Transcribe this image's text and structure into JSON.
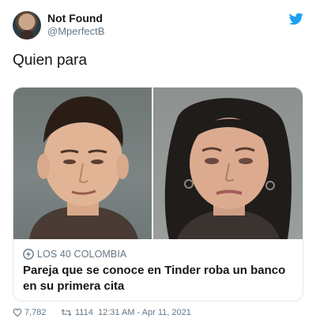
{
  "tweet": {
    "user_name": "Not Found",
    "user_handle": "@MperfectB",
    "text": "Quien para"
  },
  "card": {
    "source": "LOS 40 COLOMBIA",
    "title": "Pareja que se conoce en Tinder roba un banco en su primera cita",
    "images": [
      "photo-man-mugshot",
      "photo-woman-mugshot"
    ]
  },
  "stats": {
    "likes": "7,782",
    "retweets": "1114",
    "timestamp": "12:31 AM - Apr 11, 2021"
  },
  "colors": {
    "twitter_blue": "#1da1f2",
    "secondary_text": "#657786",
    "border": "#e1e8ed"
  },
  "icons": [
    "twitter-bird-icon",
    "bolt-icon",
    "heart-icon",
    "retweet-icon"
  ]
}
